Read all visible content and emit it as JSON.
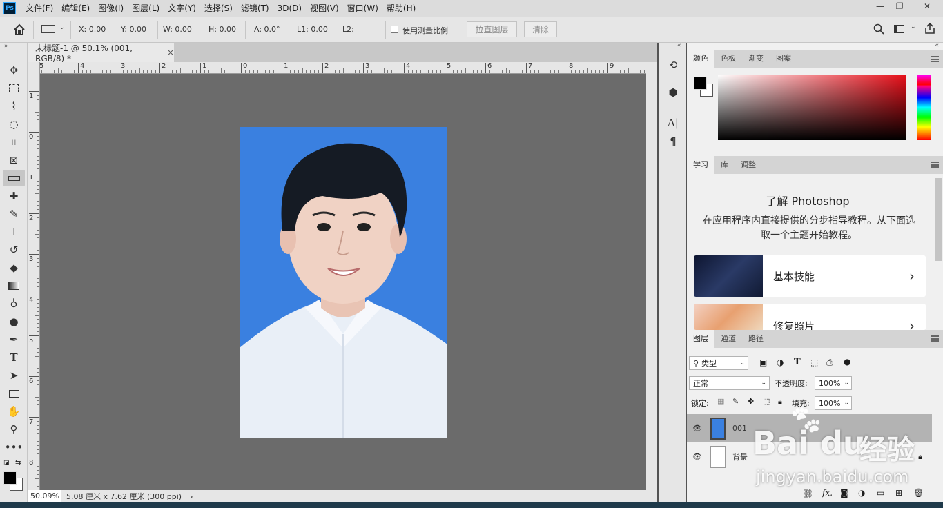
{
  "menubar": {
    "app_logo": "Ps",
    "items": [
      "文件(F)",
      "编辑(E)",
      "图像(I)",
      "图层(L)",
      "文字(Y)",
      "选择(S)",
      "滤镜(T)",
      "3D(D)",
      "视图(V)",
      "窗口(W)",
      "帮助(H)"
    ]
  },
  "options": {
    "x": "X: 0.00",
    "y": "Y: 0.00",
    "w": "W: 0.00",
    "h": "H: 0.00",
    "a": "A: 0.0°",
    "l1": "L1: 0.00",
    "l2": "L2:",
    "use_scale": "使用测量比例",
    "straighten": "拉直图层",
    "clear": "清除"
  },
  "document": {
    "tab_title": "未标题-1 @ 50.1% (001, RGB/8) *",
    "close": "×",
    "ruler_h": [
      "5",
      "4",
      "3",
      "2",
      "1",
      "0",
      "1",
      "2",
      "3",
      "4",
      "5",
      "6",
      "7",
      "8",
      "9"
    ],
    "ruler_v": [
      "1",
      "0",
      "1",
      "2",
      "3",
      "4",
      "5",
      "6",
      "7",
      "8"
    ]
  },
  "status": {
    "zoom": "50.09%",
    "doc_size": "5.08 厘米 x 7.62 厘米 (300 ppi)",
    "arrow": "›"
  },
  "color_panel": {
    "tabs": [
      "颜色",
      "色板",
      "渐变",
      "图案"
    ],
    "fg": "#000000",
    "bg": "#ffffff"
  },
  "learn_panel": {
    "tabs": [
      "学习",
      "库",
      "调整"
    ],
    "title": "了解 Photoshop",
    "description": "在应用程序内直接提供的分步指导教程。从下面选取一个主题开始教程。",
    "cards": [
      {
        "label": "基本技能"
      },
      {
        "label": "修复照片"
      }
    ]
  },
  "layers_panel": {
    "tabs": [
      "图层",
      "通道",
      "路径"
    ],
    "filter": "类型",
    "blend_mode": "正常",
    "opacity_label": "不透明度:",
    "opacity": "100%",
    "lock_label": "锁定:",
    "fill_label": "填充:",
    "fill": "100%",
    "layers": [
      {
        "name": "001",
        "selected": true
      },
      {
        "name": "背景",
        "locked": true
      }
    ]
  },
  "watermark": {
    "brand": "Bai",
    "brand2": "du",
    "cn": "经验",
    "url": "jingyan.baidu.com"
  },
  "colors": {
    "accent": "#3a80e0",
    "selected_layer": "#b3b3b3"
  }
}
